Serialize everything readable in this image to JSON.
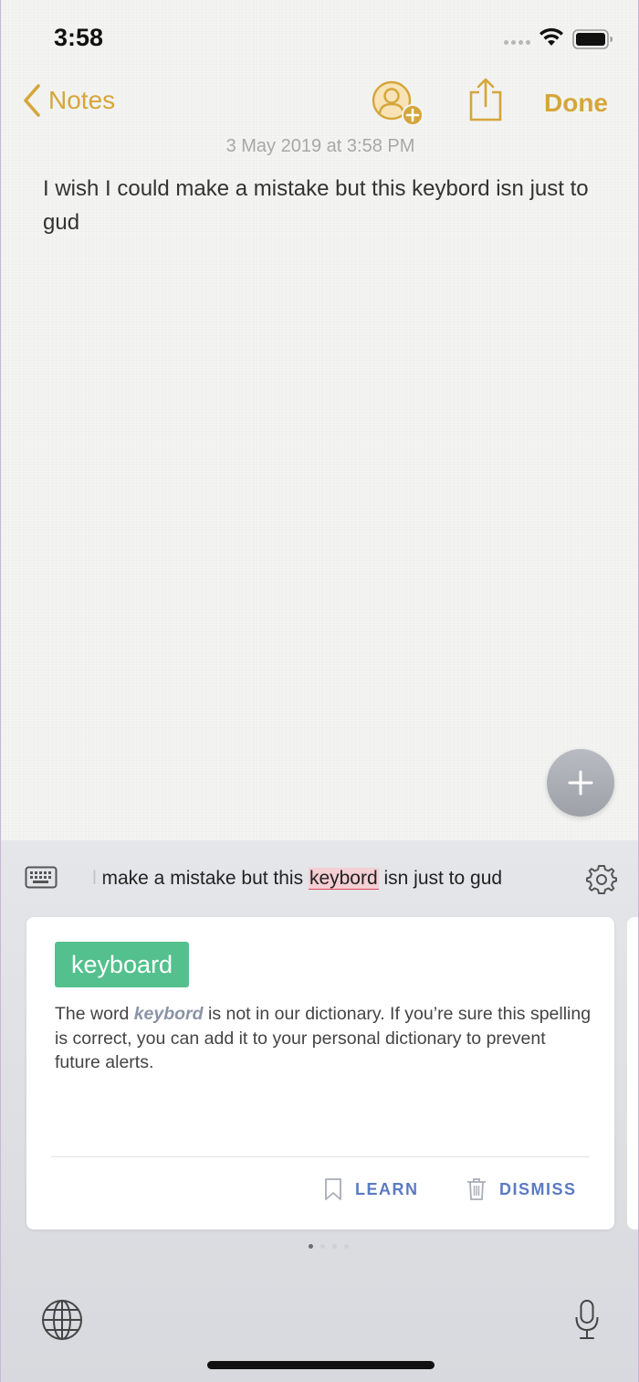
{
  "status_bar": {
    "time": "3:58"
  },
  "nav": {
    "back_label": "Notes",
    "done_label": "Done"
  },
  "note": {
    "date": "3 May 2019 at 3:58 PM",
    "body": "I wish I could make a mistake but this keybord isn't just to gud",
    "body_text": "I wish I could make a mistake but this keybord isn just to gud"
  },
  "keyboard": {
    "preview_before": "l make a mistake but this ",
    "preview_error": "keybord",
    "preview_after": " isn just to gud",
    "suggestion": "keyboard",
    "message_before": "The word ",
    "message_word": "keybord",
    "message_after": " is not in our dictionary. If you’re sure this spelling is correct, you can add it to your personal dictionary to prevent future alerts.",
    "learn_label": "LEARN",
    "dismiss_label": "DISMISS",
    "page_count": 4,
    "active_page": 1
  },
  "colors": {
    "accent": "#d5a63a",
    "suggestion_bg": "#54c08d",
    "action_text": "#5b7ac2",
    "error_underline": "#e0495b"
  },
  "icons": [
    "back-chevron-icon",
    "add-person-icon",
    "share-icon",
    "plus-icon",
    "keyboard-icon",
    "gear-icon",
    "bookmark-icon",
    "trash-icon",
    "globe-icon",
    "microphone-icon",
    "wifi-icon",
    "battery-icon"
  ]
}
